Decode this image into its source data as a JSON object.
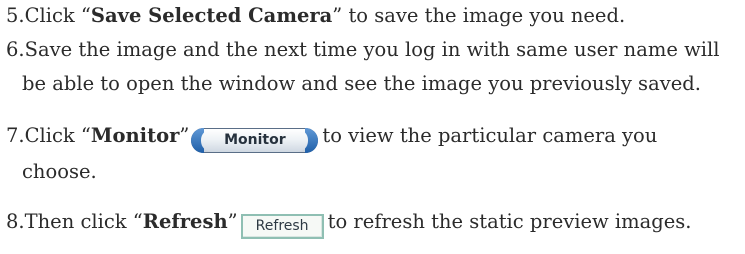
{
  "steps": [
    {
      "prefix": "5.Click “",
      "bold": "Save Selected Camera",
      "suffix": "” to save the image you need."
    },
    {
      "line1": "6.Save the image and the next time you log in with same user name will",
      "line2": "be able to open the window and see the image you previously saved."
    },
    {
      "prefix": "7.Click “",
      "bold": "Monitor",
      "mid": "”",
      "button_label": "Monitor",
      "suffix": "to view the particular camera you",
      "line2": "choose."
    },
    {
      "prefix": "8.Then click “",
      "bold": "Refresh",
      "mid": "”",
      "button_label": "Refresh",
      "suffix": "to refresh the static preview images."
    }
  ]
}
